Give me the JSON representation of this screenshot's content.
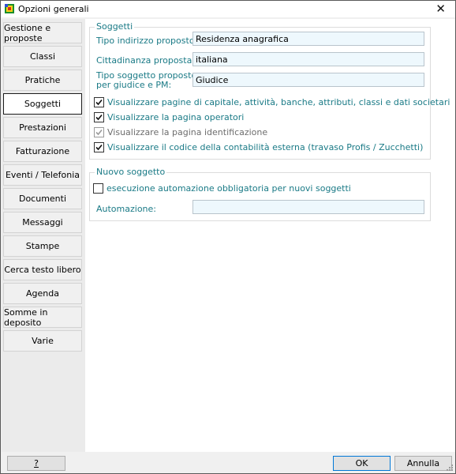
{
  "window": {
    "title": "Opzioni generali",
    "icon": "app-icon"
  },
  "nav": {
    "items": [
      {
        "label": "Gestione e proposte",
        "active": false
      },
      {
        "label": "Classi",
        "active": false
      },
      {
        "label": "Pratiche",
        "active": false
      },
      {
        "label": "Soggetti",
        "active": true
      },
      {
        "label": "Prestazioni",
        "active": false
      },
      {
        "label": "Fatturazione",
        "active": false
      },
      {
        "label": "Eventi / Telefonia",
        "active": false
      },
      {
        "label": "Documenti",
        "active": false
      },
      {
        "label": "Messaggi",
        "active": false
      },
      {
        "label": "Stampe",
        "active": false
      },
      {
        "label": "Cerca testo libero",
        "active": false
      },
      {
        "label": "Agenda",
        "active": false
      },
      {
        "label": "Somme in deposito",
        "active": false
      },
      {
        "label": "Varie",
        "active": false
      }
    ]
  },
  "soggetti": {
    "title": "Soggetti",
    "fields": [
      {
        "label": "Tipo indirizzo proposto:",
        "value": "Residenza anagrafica"
      },
      {
        "label": "Cittadinanza proposta:",
        "value": "italiana"
      },
      {
        "label_line1": "Tipo soggetto proposto",
        "label_line2": "per giudice e PM:",
        "value": "Giudice"
      }
    ],
    "checks": [
      {
        "label": "Visualizzare pagine di capitale, attività, banche, attributi, classi e dati societari",
        "checked": true,
        "disabled": false
      },
      {
        "label": "Visualizzare la pagina operatori",
        "checked": true,
        "disabled": false
      },
      {
        "label": "Visualizzare la pagina identificazione",
        "checked": true,
        "disabled": true
      },
      {
        "label": "Visualizzare il codice della contabilità esterna (travaso Profis / Zucchetti)",
        "checked": true,
        "disabled": false
      }
    ]
  },
  "nuovo": {
    "title": "Nuovo soggetto",
    "check": {
      "label": "esecuzione automazione obbligatoria per nuovi soggetti",
      "checked": false
    },
    "automazione_label": "Automazione:",
    "automazione_value": ""
  },
  "buttons": {
    "help": "?",
    "ok": "OK",
    "cancel": "Annulla"
  },
  "colors": {
    "accent_text": "#1a7a86",
    "field_bg": "#eef8fd",
    "default_button_border": "#0078d7"
  }
}
